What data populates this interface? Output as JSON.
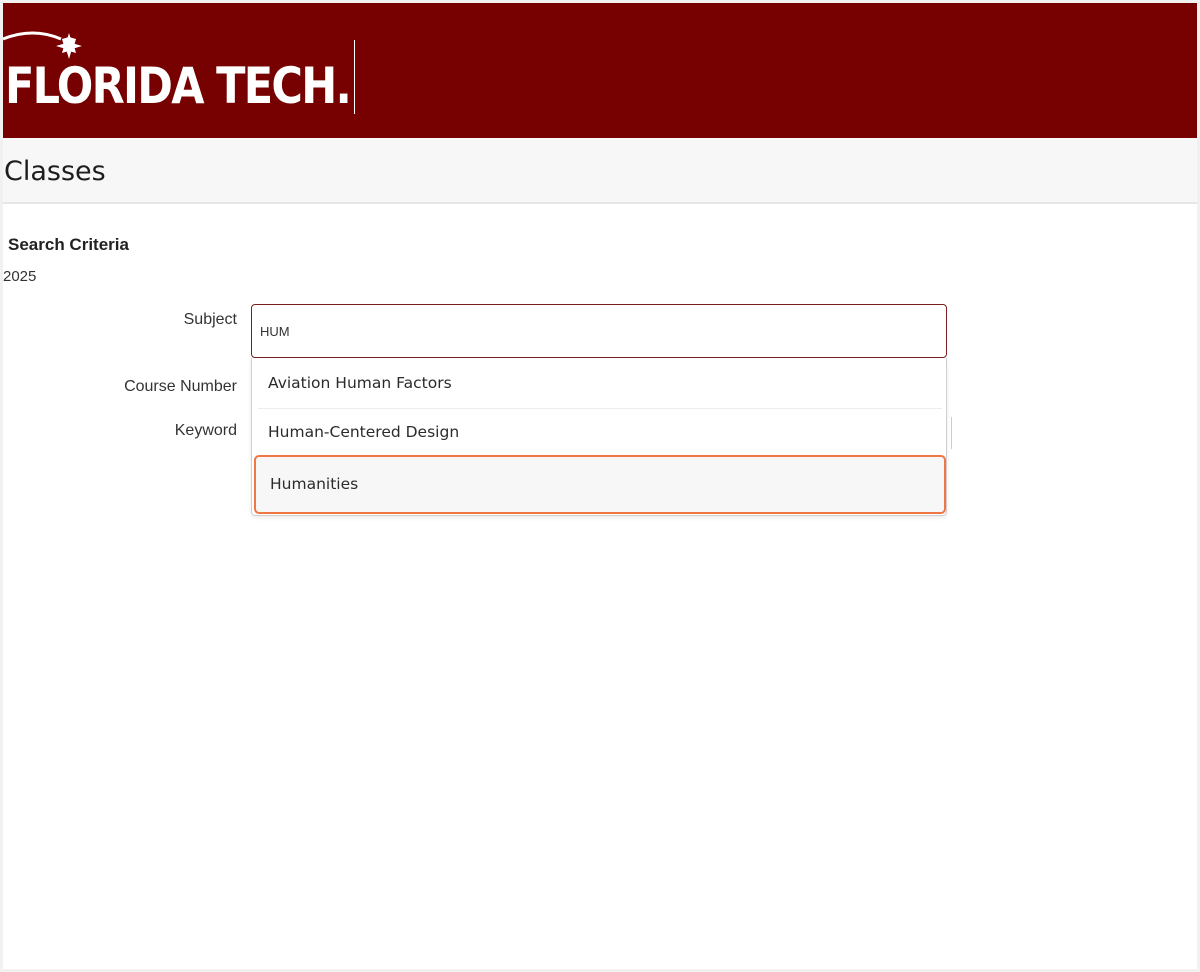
{
  "header": {
    "logo_text": "FLORIDA TECH.",
    "brand_color": "#770000"
  },
  "page": {
    "title": "Classes"
  },
  "search": {
    "section_title": "Search Criteria",
    "term": "2025",
    "subject_label": "Subject",
    "subject_value": "HUM",
    "course_number_label": "Course Number",
    "keyword_label": "Keyword",
    "highlight_color": "#ee7744"
  },
  "dropdown": {
    "options": [
      {
        "label": "Aviation Human Factors"
      },
      {
        "label": "Human-Centered Design"
      },
      {
        "label": "Humanities"
      }
    ]
  }
}
